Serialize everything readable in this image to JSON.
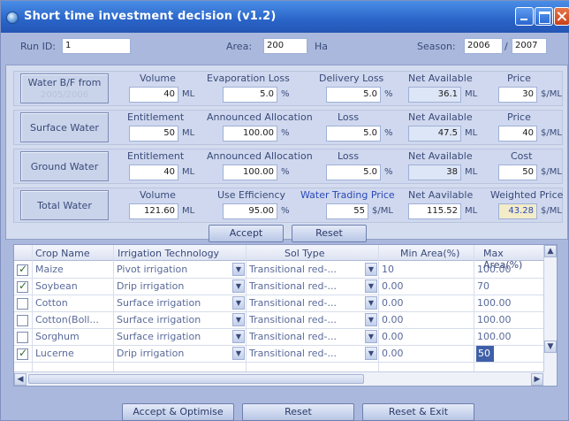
{
  "window": {
    "title": "Short time investment decision (v1.2)"
  },
  "top": {
    "run_id_label": "Run ID:",
    "run_id": "1",
    "area_label": "Area:",
    "area": "200",
    "area_unit": "Ha",
    "season_label": "Season:",
    "season_start": "2006",
    "season_sep": "/",
    "season_end": "2007"
  },
  "water_bf": {
    "title": "Water B/F from",
    "subtitle": "2005/2006",
    "h1": "Volume",
    "h2": "Evaporation Loss",
    "h3": "Delivery Loss",
    "h4": "Net Available",
    "h5": "Price",
    "v1": "40",
    "u1": "ML",
    "v2": "5.0",
    "u2": "%",
    "v3": "5.0",
    "u3": "%",
    "v4": "36.1",
    "u4": "ML",
    "v5": "30",
    "u5": "$/ML"
  },
  "surface": {
    "title": "Surface Water",
    "h1": "Entitlement",
    "h2": "Announced Allocation",
    "h3": "Loss",
    "h4": "Net Available",
    "h5": "Price",
    "v1": "50",
    "u1": "ML",
    "v2": "100.00",
    "u2": "%",
    "v3": "5.0",
    "u3": "%",
    "v4": "47.5",
    "u4": "ML",
    "v5": "40",
    "u5": "$/ML"
  },
  "ground": {
    "title": "Ground Water",
    "h1": "Entitlement",
    "h2": "Announced Allocation",
    "h3": "Loss",
    "h4": "Net Available",
    "h5": "Cost",
    "v1": "40",
    "u1": "ML",
    "v2": "100.00",
    "u2": "%",
    "v3": "5.0",
    "u3": "%",
    "v4": "38",
    "u4": "ML",
    "v5": "50",
    "u5": "$/ML"
  },
  "total": {
    "title": "Total Water",
    "h1": "Volume",
    "h2": "Use Efficiency",
    "h3": "Water Trading Price",
    "h4": "Net Aavilable",
    "h5": "Weighted Price",
    "v1": "121.60",
    "u1": "ML",
    "v2": "95.00",
    "u2": "%",
    "v3": "55",
    "u3": "$/ML",
    "v4": "115.52",
    "u4": "ML",
    "v5": "43.28",
    "u5": "$/ML"
  },
  "buttons": {
    "accept": "Accept",
    "reset": "Reset",
    "accept_optimise": "Accept & Optimise",
    "reset_bottom": "Reset",
    "reset_exit": "Reset & Exit"
  },
  "grid": {
    "headers": [
      "Crop Name",
      "Irrigation Technology",
      "Sol Type",
      "Min Area(%)",
      "Max Area(%)"
    ],
    "rows": [
      {
        "checked": true,
        "crop": "Maize",
        "irr": "Pivot irrigation",
        "soil": "Transitional red-...",
        "min": "10",
        "max": "100.00"
      },
      {
        "checked": true,
        "crop": "Soybean",
        "irr": "Drip irrigation",
        "soil": "Transitional red-...",
        "min": "0.00",
        "max": "70"
      },
      {
        "checked": false,
        "crop": "Cotton",
        "irr": "Surface irrigation",
        "soil": "Transitional red-...",
        "min": "0.00",
        "max": "100.00"
      },
      {
        "checked": false,
        "crop": "Cotton(Boll...",
        "irr": "Surface irrigation",
        "soil": "Transitional red-...",
        "min": "0.00",
        "max": "100.00"
      },
      {
        "checked": false,
        "crop": "Sorghum",
        "irr": "Surface irrigation",
        "soil": "Transitional red-...",
        "min": "0.00",
        "max": "100.00"
      },
      {
        "checked": true,
        "crop": "Lucerne",
        "irr": "Drip irrigation",
        "soil": "Transitional red-...",
        "min": "0.00",
        "max": "50"
      }
    ]
  }
}
